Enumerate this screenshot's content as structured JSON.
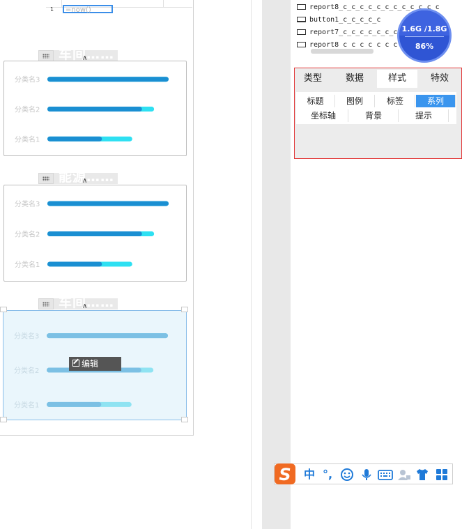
{
  "canvas": {
    "formula_text": "=now()",
    "row_number": "1",
    "widgets": [
      {
        "title": "车间……",
        "caret": "∧"
      },
      {
        "title": "能源……",
        "caret": "∧"
      },
      {
        "title": "车间……",
        "caret": "∧"
      }
    ],
    "edit_button_label": "编辑"
  },
  "chart_data": [
    {
      "type": "bar",
      "categories": [
        "分类名3",
        "分类名2",
        "分类名1"
      ],
      "series": [
        {
          "values": [
            100,
            78,
            45
          ]
        },
        {
          "values": [
            100,
            88,
            70
          ]
        }
      ]
    },
    {
      "type": "bar",
      "categories": [
        "分类名3",
        "分类名2",
        "分类名1"
      ],
      "series": [
        {
          "values": [
            100,
            78,
            45
          ]
        },
        {
          "values": [
            100,
            88,
            70
          ]
        }
      ]
    },
    {
      "type": "bar",
      "categories": [
        "分类名3",
        "分类名2",
        "分类名1"
      ],
      "series": [
        {
          "values": [
            100,
            78,
            45
          ]
        },
        {
          "values": [
            100,
            88,
            70
          ]
        }
      ]
    }
  ],
  "widget_list": {
    "items": [
      {
        "label": "report8_c_c_c_c_c_c_c_c_c_c_c_c",
        "icon": "report-icon"
      },
      {
        "label": "button1_c_c_c_c_c",
        "icon": "button-icon"
      },
      {
        "label": "report7_c_c_c_c_c_c_c",
        "icon": "report-icon"
      },
      {
        "label": "report8 c c c c c c c c c",
        "icon": "report-icon"
      }
    ]
  },
  "memory": {
    "usage": "1.6G /1.8G",
    "percent": "86%"
  },
  "properties": {
    "tabs": [
      "类型",
      "数据",
      "样式",
      "特效"
    ],
    "active_tab": "样式",
    "sub_tabs_row1": [
      "标题",
      "图例",
      "标签",
      "系列"
    ],
    "sub_tabs_row2": [
      "坐标轴",
      "背景",
      "提示"
    ],
    "active_sub_tab": "系列"
  },
  "ime": {
    "items": [
      "中",
      "°,",
      "emoji-icon",
      "mic-icon",
      "keyboard-icon",
      "user-icon",
      "shirt-icon",
      "grid-icon"
    ],
    "lang_label": "中",
    "punct_label": "°,"
  },
  "colors": {
    "bar_dark": "#1a8fd2",
    "bar_light": "#2ee0f2",
    "selection_border": "#e2393a",
    "active_blue": "#3a95ee"
  }
}
